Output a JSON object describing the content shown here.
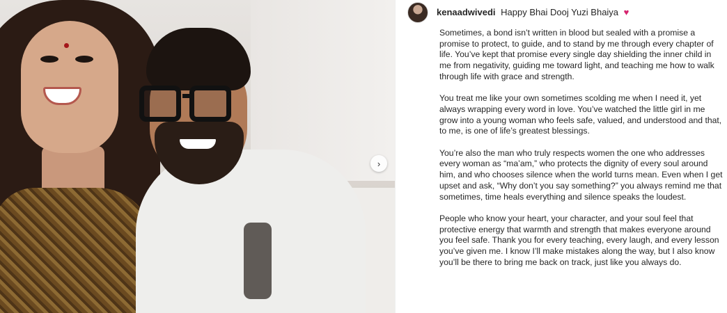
{
  "post": {
    "username": "kenaadwivedi",
    "title": "Happy Bhai Dooj Yuzi Bhaiya",
    "title_emoji": "♥",
    "carousel_next_glyph": "›"
  },
  "caption": {
    "paragraphs": [
      "Sometimes, a bond isn’t written in blood but sealed with a promise a promise to protect, to guide, and to stand by me through every chapter of life. You’ve kept that promise every single day shielding the inner child in me from negativity, guiding me toward light, and teaching me how to walk through life with grace and strength.",
      "You treat me like your own sometimes scolding me when I need it, yet always wrapping every word in love. You’ve watched the little girl in me grow into a young woman who feels safe, valued, and understood and that, to me, is one of life’s greatest blessings.",
      "You’re also the man who truly respects women the one who addresses every woman as “ma’am,” who protects the dignity of every soul around him, and who chooses silence when the world turns mean. Even when I get upset and ask, “Why don’t you say something?” you always remind me that sometimes, time heals everything and silence speaks the loudest.",
      "People who know your heart, your character, and your soul feel that protective energy that warmth and strength that makes everyone around you feel safe. Thank you for every teaching, every laugh, and every lesson you’ve given me. I know I’ll make mistakes along the way, but I also know you’ll be there to bring me back on track, just like you always do."
    ]
  },
  "colors": {
    "heart": "#d6246e",
    "text": "#262626"
  }
}
